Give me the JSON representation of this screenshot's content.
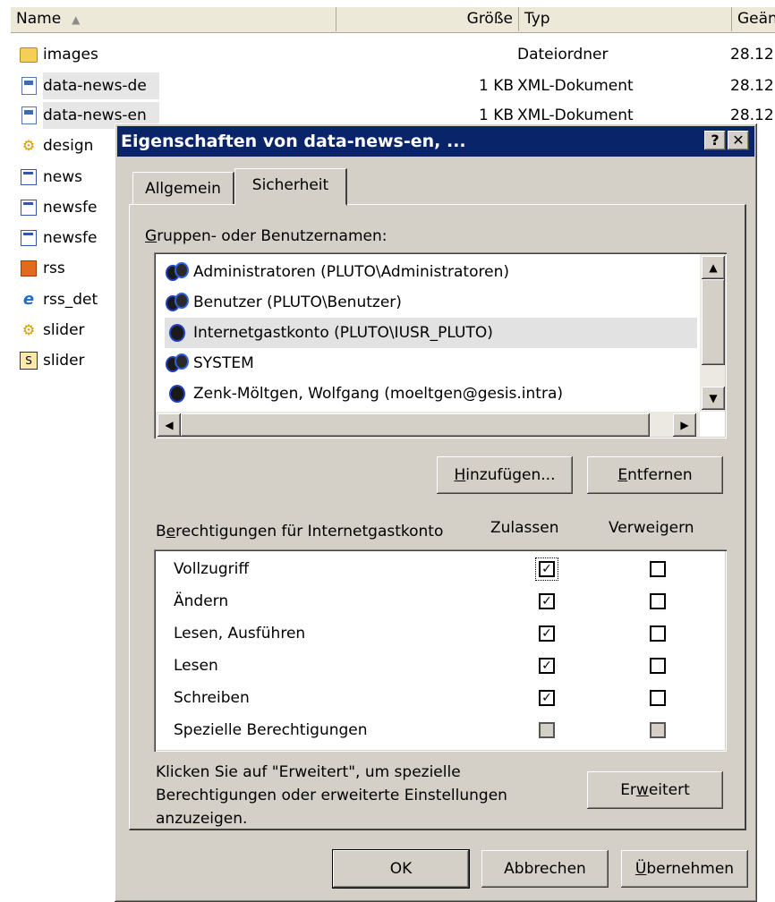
{
  "explorer": {
    "columns": {
      "name": "Name",
      "size": "Größe",
      "type": "Typ",
      "date": "Geän"
    },
    "files": [
      {
        "name": "images",
        "size": "",
        "type": "Dateiordner",
        "date": "28.12",
        "icon": "folder-icon"
      },
      {
        "name": "data-news-de",
        "size": "1 KB",
        "type": "XML-Dokument",
        "date": "28.12",
        "icon": "xml-document-icon"
      },
      {
        "name": "data-news-en",
        "size": "1 KB",
        "type": "XML-Dokument",
        "date": "28.12",
        "icon": "xml-document-icon"
      },
      {
        "name": "design",
        "icon": "script-icon"
      },
      {
        "name": "news",
        "icon": "web-document-icon"
      },
      {
        "name": "newsfe",
        "icon": "web-document-icon"
      },
      {
        "name": "newsfe",
        "icon": "web-document-icon"
      },
      {
        "name": "rss",
        "icon": "rss-icon"
      },
      {
        "name": "rss_det",
        "icon": "internet-explorer-icon"
      },
      {
        "name": "slider",
        "icon": "script-icon"
      },
      {
        "name": "slider",
        "icon": "flash-icon"
      }
    ]
  },
  "dialog": {
    "title": "Eigenschaften von data-news-en, ...",
    "help_button": "?",
    "close_button": "✕",
    "tabs": [
      {
        "label": "Allgemein"
      },
      {
        "label": "Sicherheit"
      }
    ],
    "groups_label_accel": "G",
    "groups_label_rest": "ruppen- oder Benutzernamen:",
    "users": [
      {
        "name": "Administratoren (PLUTO\\Administratoren)"
      },
      {
        "name": "Benutzer (PLUTO\\Benutzer)"
      },
      {
        "name": "Internetgastkonto (PLUTO\\IUSR_PLUTO)"
      },
      {
        "name": "SYSTEM"
      },
      {
        "name": "Zenk-Möltgen, Wolfgang (moeltgen@gesis.intra)"
      }
    ],
    "add_button": {
      "accel": "H",
      "rest": "inzufügen..."
    },
    "remove_button": {
      "accel": "E",
      "rest": "ntfernen"
    },
    "permissions_label_pre": "B",
    "permissions_label_accel": "e",
    "permissions_label_rest": "rechtigungen für Internetgastkonto",
    "col_allow": "Zulassen",
    "col_deny": "Verweigern",
    "permissions": [
      {
        "name": "Vollzugriff",
        "allow": true,
        "deny": false
      },
      {
        "name": "Ändern",
        "allow": true,
        "deny": false
      },
      {
        "name": "Lesen, Ausführen",
        "allow": true,
        "deny": false
      },
      {
        "name": "Lesen",
        "allow": true,
        "deny": false
      },
      {
        "name": "Schreiben",
        "allow": true,
        "deny": false
      },
      {
        "name": "Spezielle Berechtigungen",
        "allow": false,
        "deny": false
      }
    ],
    "advanced_hint_line1": "Klicken Sie auf \"Erweitert\", um spezielle",
    "advanced_hint_line2": "Berechtigungen oder erweiterte Einstellungen",
    "advanced_hint_line3": "anzuzeigen.",
    "advanced_button": {
      "pre": "Er",
      "accel": "w",
      "rest": "eitert"
    },
    "ok_button": "OK",
    "cancel_button": "Abbrechen",
    "apply_button": {
      "accel": "Ü",
      "rest": "bernehmen"
    }
  },
  "colors": {
    "titlebar": "#0a246a",
    "face": "#d4d0c8",
    "selection": "#e2e2e2"
  }
}
